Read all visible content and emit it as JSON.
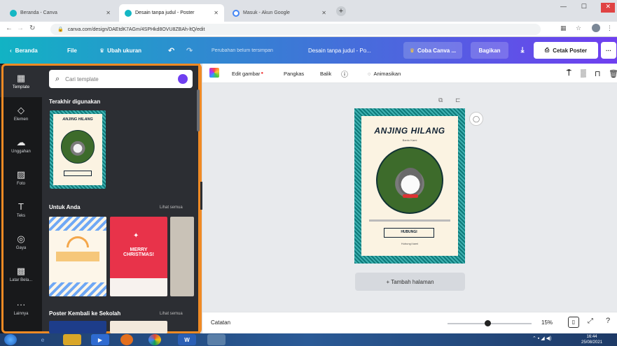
{
  "browser": {
    "tabs": [
      {
        "label": "Beranda - Canva",
        "active": false
      },
      {
        "label": "Desain tanpa judul - Poster",
        "active": true
      },
      {
        "label": "Masuk - Akun Google",
        "active": false
      }
    ],
    "url": "canva.com/design/DAEtdK7AGm/4SPHkd8OVU8ZBAh-ltQ/edit"
  },
  "header": {
    "back_label": "Beranda",
    "file_label": "File",
    "resize_label": "Ubah ukuran",
    "unsaved_label": "Perubahan belum tersimpan",
    "title": "Desain tanpa judul - Po...",
    "try_label": "Coba Canva ...",
    "share_label": "Bagikan",
    "print_label": "Cetak Poster",
    "more_label": "···"
  },
  "rail": [
    {
      "label": "Template",
      "icon": "▦"
    },
    {
      "label": "Elemen",
      "icon": "◇"
    },
    {
      "label": "Unggahan",
      "icon": "☁"
    },
    {
      "label": "Foto",
      "icon": "▨"
    },
    {
      "label": "Teks",
      "icon": "T"
    },
    {
      "label": "Gaya",
      "icon": "◎"
    },
    {
      "label": "Latar Bela...",
      "icon": "▩"
    },
    {
      "label": "Lainnya",
      "icon": "···"
    }
  ],
  "panel": {
    "search_placeholder": "Cari template",
    "recent_title": "Terakhir digunakan",
    "foryou_title": "Untuk Anda",
    "see_all_1": "Lihat semua",
    "school_title": "Poster Kembali ke Sekolah",
    "see_all_2": "Lihat semua",
    "card_christmas": "MERRY CHRISTMAS!"
  },
  "toolbar": {
    "edit_image": "Edit gambar",
    "crop": "Pangkas",
    "flip": "Balik",
    "animate": "Animasikan"
  },
  "poster": {
    "title": "ANJING HILANG",
    "subtitle": "Bantu Kami",
    "button_text": "HUBUNGI",
    "footer": "Hubungi kami"
  },
  "canvas": {
    "add_page": "+ Tambah halaman"
  },
  "bottom": {
    "notes_label": "Catatan",
    "zoom": "15%",
    "zoom_fraction": 0.15
  },
  "taskbar": {
    "time": "16:44",
    "date": "25/08/2021"
  },
  "colors": {
    "accent_orange": "#f08a24",
    "poster_border": "#0e7a7a",
    "header_start": "#12b3c4",
    "header_end": "#6f3ff0"
  }
}
